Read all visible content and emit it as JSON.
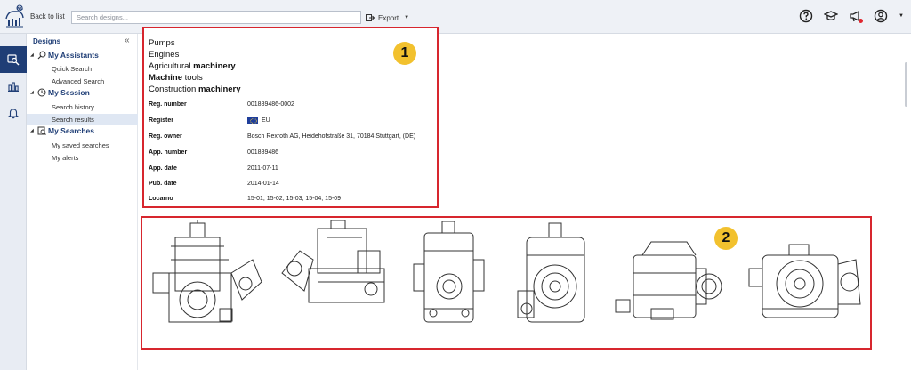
{
  "topbar": {
    "back_label": "Back to list",
    "search_placeholder": "Search designs...",
    "export_label": "Export",
    "icons": [
      "help-icon",
      "graduation-cap-icon",
      "megaphone-icon",
      "user-account-icon"
    ],
    "accent": "#1f3e76"
  },
  "rail": {
    "items": [
      "design-search-icon",
      "statistics-icon",
      "alerts-bell-icon"
    ]
  },
  "nav": {
    "title": "Designs",
    "collapse_symbol": "«",
    "groups": [
      {
        "label": "My Assistants",
        "items": [
          "Quick Search",
          "Advanced Search"
        ]
      },
      {
        "label": "My Session",
        "items": [
          "Search history",
          "Search results"
        ]
      },
      {
        "label": "My Searches",
        "items": [
          "My saved searches",
          "My alerts"
        ]
      }
    ],
    "active_item": "Search results"
  },
  "detail": {
    "badge": "1",
    "categories": [
      {
        "plain": "Pumps",
        "bold": "",
        "after": ""
      },
      {
        "plain": "Engines",
        "bold": "",
        "after": ""
      },
      {
        "plain": "Agricultural ",
        "bold": "machinery",
        "after": ""
      },
      {
        "plain": "",
        "bold": "Machine",
        "after": " tools"
      },
      {
        "plain": "Construction ",
        "bold": "machinery",
        "after": ""
      }
    ],
    "fields": [
      {
        "label": "Reg. number",
        "value": "001889486-0002"
      },
      {
        "label": "Register",
        "value": "EU"
      },
      {
        "label": "Reg. owner",
        "value": "Bosch Rexroth AG, Heidehofstraße 31, 70184 Stuttgart, (DE)"
      },
      {
        "label": "App. number",
        "value": "001889486"
      },
      {
        "label": "App. date",
        "value": "2011-07-11"
      },
      {
        "label": "Pub. date",
        "value": "2014-01-14"
      },
      {
        "label": "Locarno",
        "value": "15-01, 15-02, 15-03, 15-04, 15-09"
      }
    ],
    "register_flag_color": "#1f3e9b"
  },
  "views": {
    "badge": "2",
    "count": 6,
    "highlight_color": "#d7262e",
    "badge_color": "#f2c12e"
  }
}
